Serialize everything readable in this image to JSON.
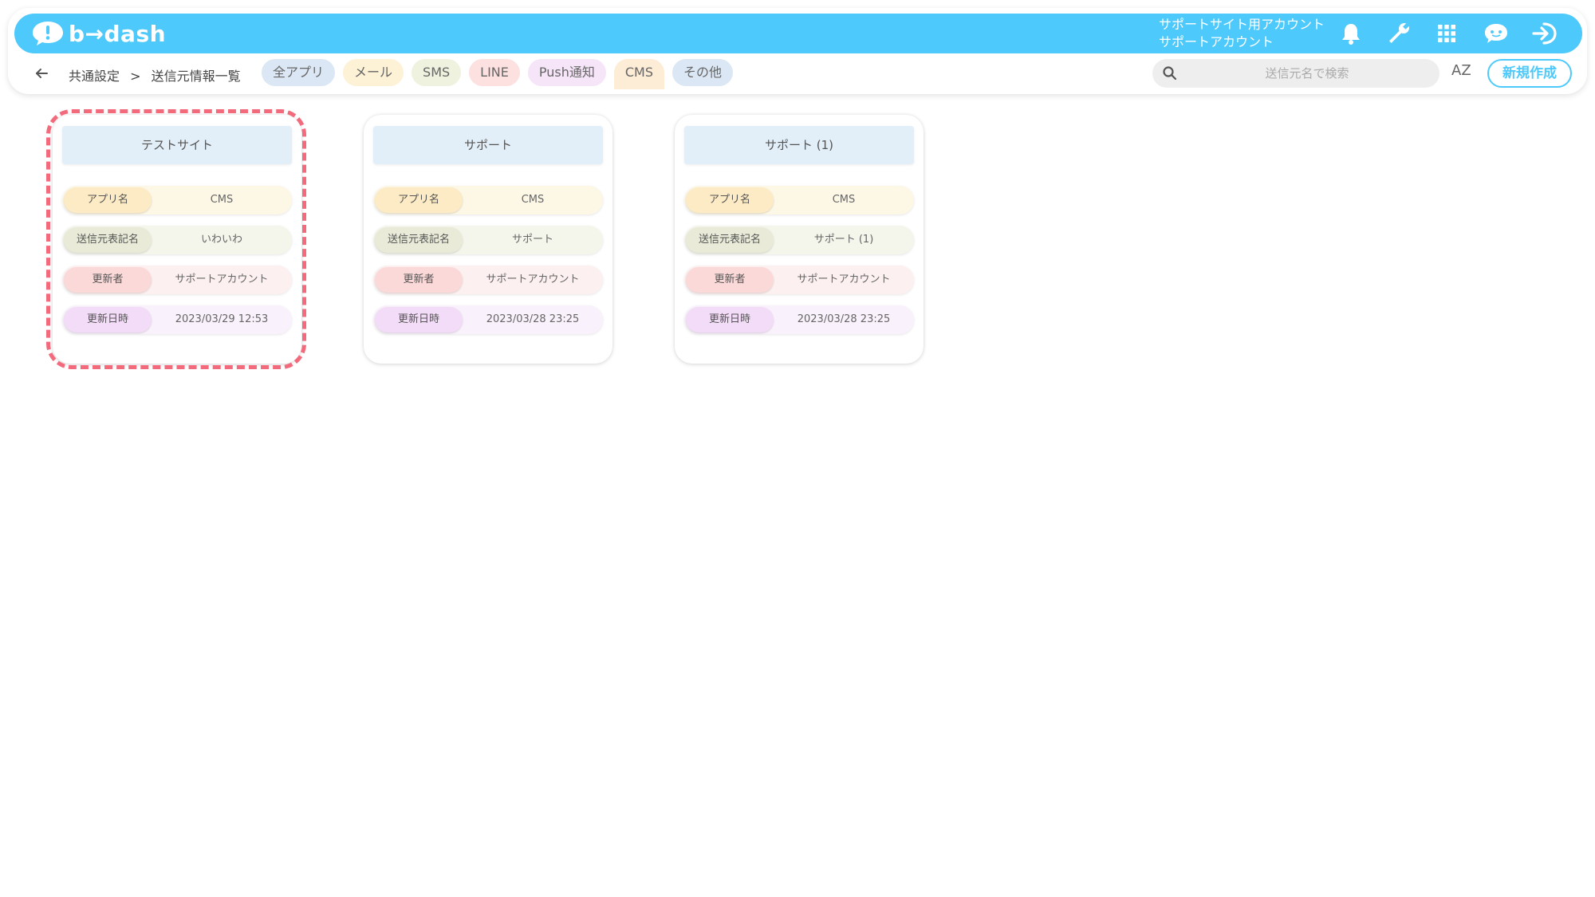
{
  "header": {
    "logo_text": "b→dash",
    "account_line1": "サポートサイト用アカウント",
    "account_line2": "サポートアカウント"
  },
  "subbar": {
    "breadcrumb_parent": "共通設定",
    "breadcrumb_sep": ">",
    "breadcrumb_current": "送信元情報一覧",
    "filters": [
      {
        "label": "全アプリ",
        "color": "#dbe7f4"
      },
      {
        "label": "メール",
        "color": "#fdf1d6"
      },
      {
        "label": "SMS",
        "color": "#eef2de"
      },
      {
        "label": "LINE",
        "color": "#fde0e0"
      },
      {
        "label": "Push通知",
        "color": "#f6e4f8"
      },
      {
        "label": "CMS",
        "color": "#fdecd6"
      },
      {
        "label": "その他",
        "color": "#dbe7f4"
      }
    ],
    "search_placeholder": "送信元名で検索",
    "sort_label": "AZ",
    "new_button": "新規作成"
  },
  "field_labels": {
    "app": "アプリ名",
    "sender": "送信元表記名",
    "updater": "更新者",
    "updated_at": "更新日時"
  },
  "cards": [
    {
      "title": "テストサイト",
      "app": "CMS",
      "sender": "いわいわ",
      "updater": "サポートアカウント",
      "updated_at": "2023/03/29 12:53"
    },
    {
      "title": "サポート",
      "app": "CMS",
      "sender": "サポート",
      "updater": "サポートアカウント",
      "updated_at": "2023/03/28 23:25"
    },
    {
      "title": "サポート (1)",
      "app": "CMS",
      "sender": "サポート (1)",
      "updater": "サポートアカウント",
      "updated_at": "2023/03/28 23:25"
    }
  ],
  "colors": {
    "brand": "#4ec9fb",
    "row_app_bg": "#fdf7e6",
    "row_app_label": "#fcebc4",
    "row_sender_bg": "#f4f5eb",
    "row_sender_label": "#e9ebd8",
    "row_updater_bg": "#fdf0f0",
    "row_updater_label": "#fcd9d9",
    "row_date_bg": "#f9f1fb",
    "row_date_label": "#f3dcf7",
    "highlight": "#f26a7c"
  },
  "icons": [
    "bell-icon",
    "wrench-icon",
    "apps-grid-icon",
    "support-chat-icon",
    "logout-icon",
    "back-arrow-icon",
    "search-icon",
    "sort-az-icon"
  ]
}
